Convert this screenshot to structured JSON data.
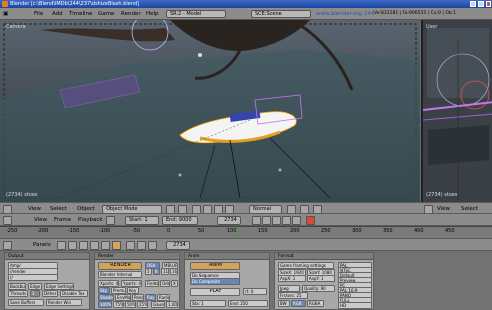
{
  "window": {
    "title": "Blender [c:\\Blend\\IMDb\\244\\237\\dshizeBlash.blend]"
  },
  "menubar": {
    "items": [
      "File",
      "Add",
      "Timeline",
      "Game",
      "Render",
      "Help"
    ],
    "screen": "SR:2 - Model",
    "scene": "SCE:Scene",
    "url": "www.blender.org 244",
    "stats": "Ve:831181 | Fa:906555 | Cu:0 | Ob:1"
  },
  "viewport_main": {
    "label": "Camera",
    "frame_label": "(2734) stoes",
    "header": {
      "view": "View",
      "select": "Select",
      "object": "Object",
      "mode": "Object Mode",
      "pivot": "Normal"
    }
  },
  "viewport_right": {
    "label": "User",
    "frame_label": "(2734) stoes",
    "header": {
      "view": "View",
      "select": "Select"
    }
  },
  "timeline_header": {
    "view": "View",
    "frame": "Frame",
    "playback": "Playback",
    "start": "Start: 1",
    "end": "End: 9000",
    "current": "2734"
  },
  "timeline": {
    "ticks": [
      "-250",
      "-200",
      "-150",
      "-100",
      "-50",
      "0",
      "50",
      "100",
      "150",
      "200",
      "250",
      "300",
      "350",
      "400",
      "450"
    ]
  },
  "buttons_header": {
    "panels": "Panels",
    "frame": "2734"
  },
  "panels": {
    "output": {
      "title": "Output",
      "fields": [
        "/tmp/",
        "//render",
        "//",
        "Backbuf",
        "Edge",
        "Edge Settings",
        "Threads",
        "1",
        "Dither",
        "Disable Tex",
        "Save Buffers",
        "Render Win"
      ]
    },
    "render": {
      "title": "Render",
      "fields": [
        "RENDER",
        "Blender Internal",
        "OSA",
        "MBLUR",
        "5",
        "8",
        "11",
        "16",
        "Xparts: 4",
        "Yparts: 4",
        "Fields",
        "Odd",
        "X",
        "Sky",
        "Premul",
        "Key",
        "Shadow",
        "EnvMap",
        "Pano",
        "Ray",
        "Radio",
        "100%",
        "75%",
        "50%",
        "25%",
        "Gauss",
        "1.00"
      ]
    },
    "anim": {
      "title": "Anim",
      "fields": [
        "ANIM",
        "Do Sequence",
        "Do Composite",
        "PLAY",
        "rt: 0",
        "Sta: 1",
        "End: 250"
      ]
    },
    "format": {
      "title": "Format",
      "fields": [
        "Game framing settings",
        "SizeX: 1920",
        "SizeY: 1080",
        "AspX: 1",
        "AspY: 1",
        "Jpeg",
        "Quality: 90",
        "Frs/sec: 25",
        "BW",
        "RGB",
        "RGBA"
      ],
      "presets": [
        "PAL",
        "NTSC",
        "Default",
        "Preview",
        "PC",
        "PAL 16:9",
        "PANO",
        "FULL",
        "HD"
      ]
    }
  }
}
